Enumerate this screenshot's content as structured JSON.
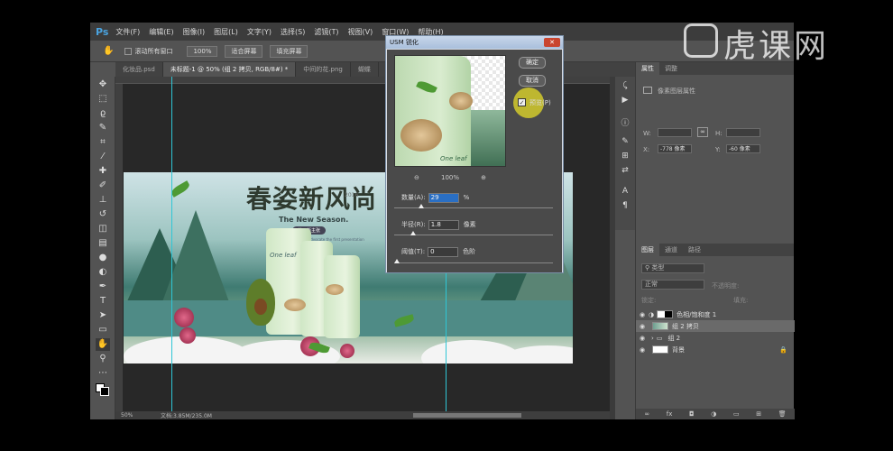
{
  "app": {
    "logo": "Ps"
  },
  "menu": [
    "文件(F)",
    "编辑(E)",
    "图像(I)",
    "图层(L)",
    "文字(Y)",
    "选择(S)",
    "滤镜(T)",
    "视图(V)",
    "窗口(W)",
    "帮助(H)"
  ],
  "options": {
    "scroll_all": "滚动所有窗口",
    "zoom": "100%",
    "fit": "适合屏幕",
    "fill": "填充屏幕"
  },
  "tabs": [
    "化妆品.psd",
    "未标题-1 @ 50% (组 2 拷贝, RGB/8#) *",
    "中间的花.png",
    "蝴蝶",
    "云.psd"
  ],
  "banner": {
    "title": "春姿新风尚",
    "year": "2016",
    "subtitle": "The New Season.",
    "pill": "美丽新主张",
    "tag": "Beautiful new advocate the first presentation",
    "brand": "One leaf"
  },
  "dialog": {
    "title": "USM 锐化",
    "ok": "确定",
    "cancel": "取消",
    "preview_label": "预览(P)",
    "zoom_out": "⊖",
    "zoom_level": "100%",
    "zoom_in": "⊕",
    "amount_label": "数量(A):",
    "amount_value": "29",
    "amount_unit": "%",
    "radius_label": "半径(R):",
    "radius_value": "1.8",
    "radius_unit": "像素",
    "threshold_label": "阈值(T):",
    "threshold_value": "0",
    "threshold_unit": "色阶",
    "preview_brand": "One leaf"
  },
  "status": {
    "zoom": "50%",
    "doc": "文档:3.85M/235.0M"
  },
  "properties": {
    "tabs": [
      "属性",
      "调整"
    ],
    "title": "像素图层属性",
    "w_label": "W:",
    "h_label": "H:",
    "x_label": "X:",
    "x_value": "-778 像素",
    "y_label": "Y:",
    "y_value": "-60 像素"
  },
  "layers_panel": {
    "tabs": [
      "图层",
      "通道",
      "路径"
    ],
    "filter": "类型",
    "blend": "正常",
    "opacity_label": "不透明度:",
    "lock_label": "锁定:",
    "fill_label": "填充:",
    "layers": [
      "色相/饱和度 1",
      "组 2 拷贝",
      "组 2",
      "背景"
    ]
  },
  "watermark": "虎课网"
}
